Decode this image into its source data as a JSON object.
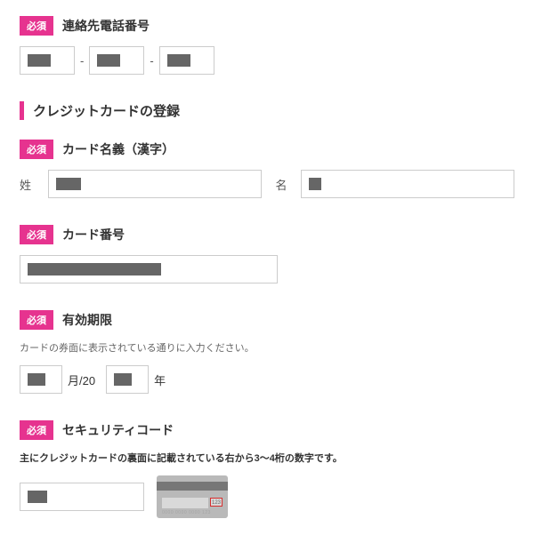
{
  "badge_text": "必須",
  "phone": {
    "label": "連絡先電話番号"
  },
  "section": {
    "title": "クレジットカードの登録"
  },
  "card_name": {
    "label": "カード名義（漢字）",
    "sei_label": "姓",
    "mei_label": "名"
  },
  "card_number": {
    "label": "カード番号"
  },
  "expiry": {
    "label": "有効期限",
    "helper": "カードの券面に表示されている通りに入力ください。",
    "month_unit": "月/20",
    "year_unit": "年"
  },
  "security": {
    "label": "セキュリティコード",
    "helper": "主にクレジットカードの裏面に記載されている右から3～4桁の数字です。",
    "sample_code": "123"
  }
}
